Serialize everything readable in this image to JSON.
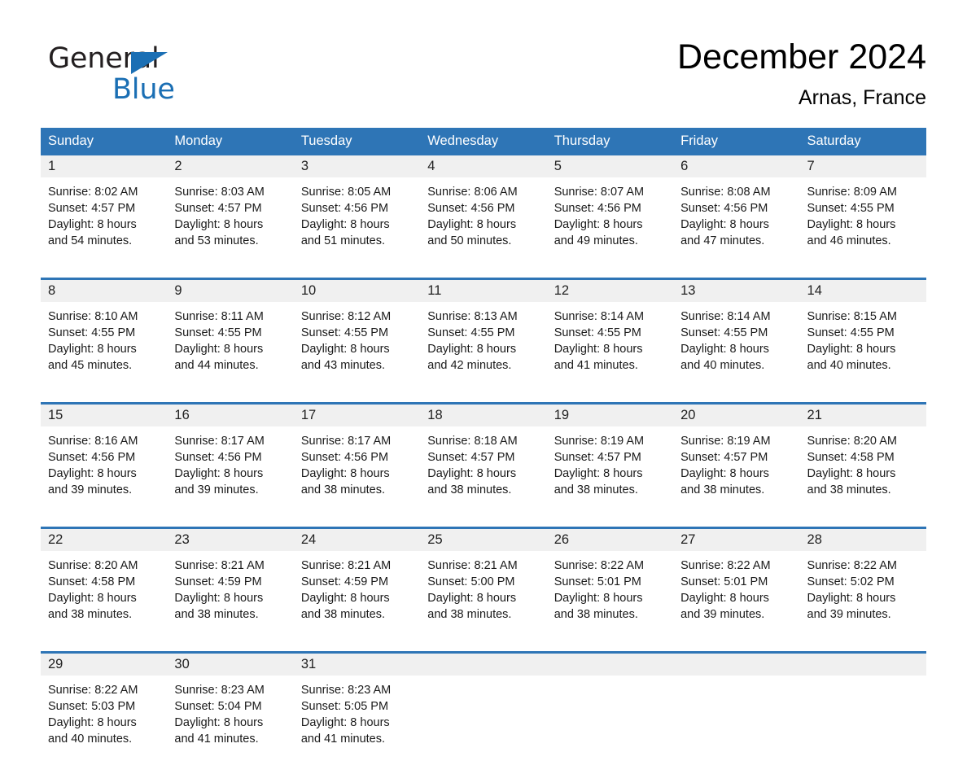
{
  "brand": {
    "word_one": "General",
    "word_two": "Blue",
    "flag_icon": "triangle-flag-icon"
  },
  "header": {
    "month_title": "December 2024",
    "location": "Arnas, France"
  },
  "theme": {
    "header_blue": "#2e75b6",
    "brand_blue": "#1b6fb4",
    "daynum_band": "#f0f0f0",
    "page_background": "#ffffff"
  },
  "calendar": {
    "weekday_headers": [
      "Sunday",
      "Monday",
      "Tuesday",
      "Wednesday",
      "Thursday",
      "Friday",
      "Saturday"
    ],
    "weeks": [
      [
        {
          "day": "1",
          "sunrise": "Sunrise: 8:02 AM",
          "sunset": "Sunset: 4:57 PM",
          "daylight_line1": "Daylight: 8 hours",
          "daylight_line2": "and 54 minutes."
        },
        {
          "day": "2",
          "sunrise": "Sunrise: 8:03 AM",
          "sunset": "Sunset: 4:57 PM",
          "daylight_line1": "Daylight: 8 hours",
          "daylight_line2": "and 53 minutes."
        },
        {
          "day": "3",
          "sunrise": "Sunrise: 8:05 AM",
          "sunset": "Sunset: 4:56 PM",
          "daylight_line1": "Daylight: 8 hours",
          "daylight_line2": "and 51 minutes."
        },
        {
          "day": "4",
          "sunrise": "Sunrise: 8:06 AM",
          "sunset": "Sunset: 4:56 PM",
          "daylight_line1": "Daylight: 8 hours",
          "daylight_line2": "and 50 minutes."
        },
        {
          "day": "5",
          "sunrise": "Sunrise: 8:07 AM",
          "sunset": "Sunset: 4:56 PM",
          "daylight_line1": "Daylight: 8 hours",
          "daylight_line2": "and 49 minutes."
        },
        {
          "day": "6",
          "sunrise": "Sunrise: 8:08 AM",
          "sunset": "Sunset: 4:56 PM",
          "daylight_line1": "Daylight: 8 hours",
          "daylight_line2": "and 47 minutes."
        },
        {
          "day": "7",
          "sunrise": "Sunrise: 8:09 AM",
          "sunset": "Sunset: 4:55 PM",
          "daylight_line1": "Daylight: 8 hours",
          "daylight_line2": "and 46 minutes."
        }
      ],
      [
        {
          "day": "8",
          "sunrise": "Sunrise: 8:10 AM",
          "sunset": "Sunset: 4:55 PM",
          "daylight_line1": "Daylight: 8 hours",
          "daylight_line2": "and 45 minutes."
        },
        {
          "day": "9",
          "sunrise": "Sunrise: 8:11 AM",
          "sunset": "Sunset: 4:55 PM",
          "daylight_line1": "Daylight: 8 hours",
          "daylight_line2": "and 44 minutes."
        },
        {
          "day": "10",
          "sunrise": "Sunrise: 8:12 AM",
          "sunset": "Sunset: 4:55 PM",
          "daylight_line1": "Daylight: 8 hours",
          "daylight_line2": "and 43 minutes."
        },
        {
          "day": "11",
          "sunrise": "Sunrise: 8:13 AM",
          "sunset": "Sunset: 4:55 PM",
          "daylight_line1": "Daylight: 8 hours",
          "daylight_line2": "and 42 minutes."
        },
        {
          "day": "12",
          "sunrise": "Sunrise: 8:14 AM",
          "sunset": "Sunset: 4:55 PM",
          "daylight_line1": "Daylight: 8 hours",
          "daylight_line2": "and 41 minutes."
        },
        {
          "day": "13",
          "sunrise": "Sunrise: 8:14 AM",
          "sunset": "Sunset: 4:55 PM",
          "daylight_line1": "Daylight: 8 hours",
          "daylight_line2": "and 40 minutes."
        },
        {
          "day": "14",
          "sunrise": "Sunrise: 8:15 AM",
          "sunset": "Sunset: 4:55 PM",
          "daylight_line1": "Daylight: 8 hours",
          "daylight_line2": "and 40 minutes."
        }
      ],
      [
        {
          "day": "15",
          "sunrise": "Sunrise: 8:16 AM",
          "sunset": "Sunset: 4:56 PM",
          "daylight_line1": "Daylight: 8 hours",
          "daylight_line2": "and 39 minutes."
        },
        {
          "day": "16",
          "sunrise": "Sunrise: 8:17 AM",
          "sunset": "Sunset: 4:56 PM",
          "daylight_line1": "Daylight: 8 hours",
          "daylight_line2": "and 39 minutes."
        },
        {
          "day": "17",
          "sunrise": "Sunrise: 8:17 AM",
          "sunset": "Sunset: 4:56 PM",
          "daylight_line1": "Daylight: 8 hours",
          "daylight_line2": "and 38 minutes."
        },
        {
          "day": "18",
          "sunrise": "Sunrise: 8:18 AM",
          "sunset": "Sunset: 4:57 PM",
          "daylight_line1": "Daylight: 8 hours",
          "daylight_line2": "and 38 minutes."
        },
        {
          "day": "19",
          "sunrise": "Sunrise: 8:19 AM",
          "sunset": "Sunset: 4:57 PM",
          "daylight_line1": "Daylight: 8 hours",
          "daylight_line2": "and 38 minutes."
        },
        {
          "day": "20",
          "sunrise": "Sunrise: 8:19 AM",
          "sunset": "Sunset: 4:57 PM",
          "daylight_line1": "Daylight: 8 hours",
          "daylight_line2": "and 38 minutes."
        },
        {
          "day": "21",
          "sunrise": "Sunrise: 8:20 AM",
          "sunset": "Sunset: 4:58 PM",
          "daylight_line1": "Daylight: 8 hours",
          "daylight_line2": "and 38 minutes."
        }
      ],
      [
        {
          "day": "22",
          "sunrise": "Sunrise: 8:20 AM",
          "sunset": "Sunset: 4:58 PM",
          "daylight_line1": "Daylight: 8 hours",
          "daylight_line2": "and 38 minutes."
        },
        {
          "day": "23",
          "sunrise": "Sunrise: 8:21 AM",
          "sunset": "Sunset: 4:59 PM",
          "daylight_line1": "Daylight: 8 hours",
          "daylight_line2": "and 38 minutes."
        },
        {
          "day": "24",
          "sunrise": "Sunrise: 8:21 AM",
          "sunset": "Sunset: 4:59 PM",
          "daylight_line1": "Daylight: 8 hours",
          "daylight_line2": "and 38 minutes."
        },
        {
          "day": "25",
          "sunrise": "Sunrise: 8:21 AM",
          "sunset": "Sunset: 5:00 PM",
          "daylight_line1": "Daylight: 8 hours",
          "daylight_line2": "and 38 minutes."
        },
        {
          "day": "26",
          "sunrise": "Sunrise: 8:22 AM",
          "sunset": "Sunset: 5:01 PM",
          "daylight_line1": "Daylight: 8 hours",
          "daylight_line2": "and 38 minutes."
        },
        {
          "day": "27",
          "sunrise": "Sunrise: 8:22 AM",
          "sunset": "Sunset: 5:01 PM",
          "daylight_line1": "Daylight: 8 hours",
          "daylight_line2": "and 39 minutes."
        },
        {
          "day": "28",
          "sunrise": "Sunrise: 8:22 AM",
          "sunset": "Sunset: 5:02 PM",
          "daylight_line1": "Daylight: 8 hours",
          "daylight_line2": "and 39 minutes."
        }
      ],
      [
        {
          "day": "29",
          "sunrise": "Sunrise: 8:22 AM",
          "sunset": "Sunset: 5:03 PM",
          "daylight_line1": "Daylight: 8 hours",
          "daylight_line2": "and 40 minutes."
        },
        {
          "day": "30",
          "sunrise": "Sunrise: 8:23 AM",
          "sunset": "Sunset: 5:04 PM",
          "daylight_line1": "Daylight: 8 hours",
          "daylight_line2": "and 41 minutes."
        },
        {
          "day": "31",
          "sunrise": "Sunrise: 8:23 AM",
          "sunset": "Sunset: 5:05 PM",
          "daylight_line1": "Daylight: 8 hours",
          "daylight_line2": "and 41 minutes."
        },
        {
          "day": "",
          "sunrise": "",
          "sunset": "",
          "daylight_line1": "",
          "daylight_line2": ""
        },
        {
          "day": "",
          "sunrise": "",
          "sunset": "",
          "daylight_line1": "",
          "daylight_line2": ""
        },
        {
          "day": "",
          "sunrise": "",
          "sunset": "",
          "daylight_line1": "",
          "daylight_line2": ""
        },
        {
          "day": "",
          "sunrise": "",
          "sunset": "",
          "daylight_line1": "",
          "daylight_line2": ""
        }
      ]
    ]
  }
}
